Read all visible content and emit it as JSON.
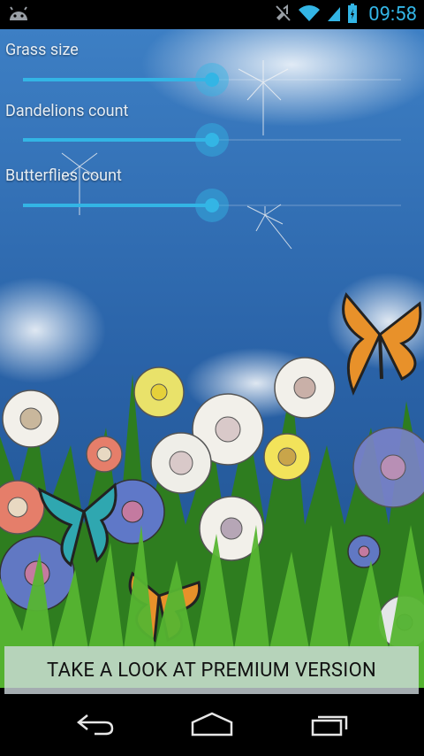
{
  "status_bar": {
    "time": "09:58",
    "icons": [
      "android-icon",
      "mute-icon",
      "wifi-icon",
      "signal-icon",
      "battery-icon"
    ]
  },
  "settings": [
    {
      "label": "Grass size",
      "value_fraction": 0.5
    },
    {
      "label": "Dandelions count",
      "value_fraction": 0.5
    },
    {
      "label": "Butterflies count",
      "value_fraction": 0.5
    }
  ],
  "premium_button": {
    "label": "TAKE A LOOK AT PREMIUM VERSION"
  },
  "nav_bar": {
    "icons": [
      "back-icon",
      "home-icon",
      "recent-apps-icon"
    ]
  },
  "colors": {
    "accent": "#33b5e5",
    "sky": "#2f6cb0",
    "grass": "#3f9a2a"
  }
}
